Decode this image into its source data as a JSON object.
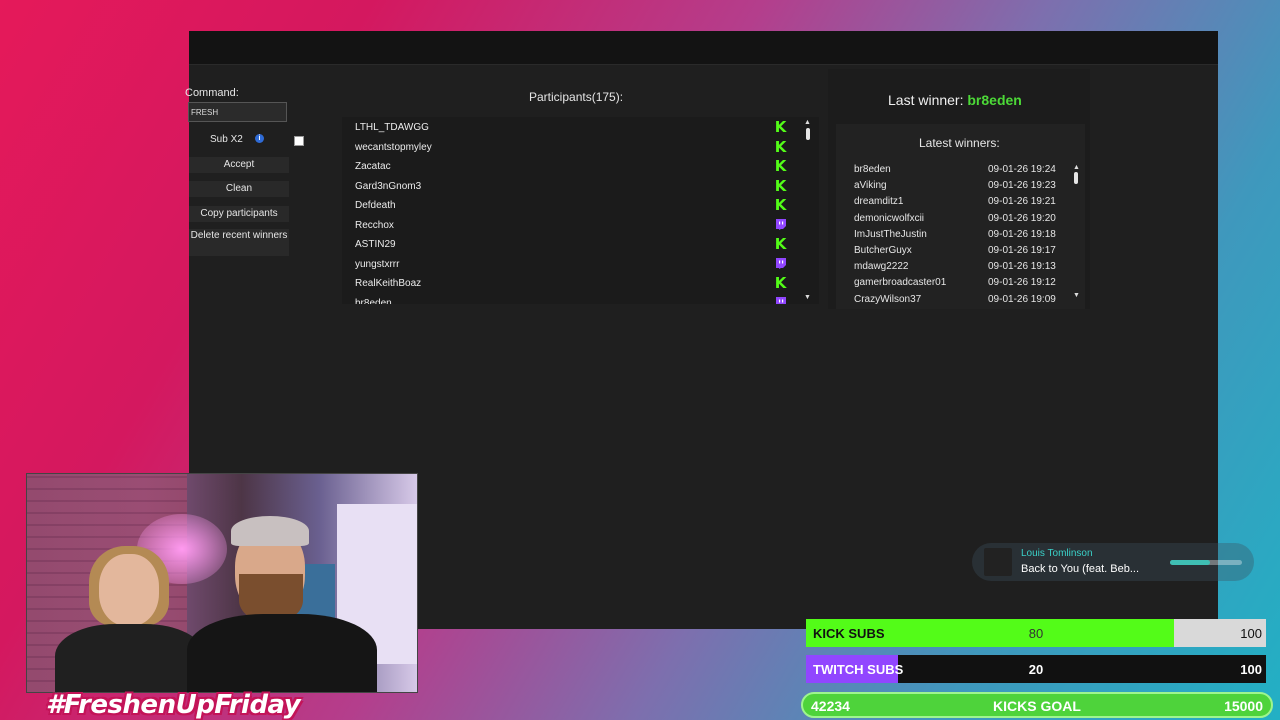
{
  "command": {
    "label": "Command:",
    "value": "FRESH"
  },
  "sub_x2": {
    "label": "Sub X2",
    "info_icon": "info-icon"
  },
  "buttons": {
    "accept": "Accept",
    "clean": "Clean",
    "copy": "Copy participants",
    "delete": "Delete recent winners"
  },
  "participants": {
    "title": "Participants(175):",
    "rows": [
      {
        "name": "LTHL_TDAWGG",
        "platform": "kick"
      },
      {
        "name": "wecantstopmyley",
        "platform": "kick"
      },
      {
        "name": "Zacatac",
        "platform": "kick"
      },
      {
        "name": "Gard3nGnom3",
        "platform": "kick"
      },
      {
        "name": "Defdeath",
        "platform": "kick"
      },
      {
        "name": "Recchox",
        "platform": "twitch"
      },
      {
        "name": "ASTIN29",
        "platform": "kick"
      },
      {
        "name": "yungstxrrr",
        "platform": "twitch"
      },
      {
        "name": "RealKeithBoaz",
        "platform": "kick"
      },
      {
        "name": "br8eden",
        "platform": "twitch"
      }
    ]
  },
  "last_winner": {
    "label": "Last winner:",
    "name": "br8eden"
  },
  "latest_winners": {
    "title": "Latest winners:",
    "rows": [
      {
        "name": "br8eden",
        "time": "09-01-26 19:24"
      },
      {
        "name": "aViking",
        "time": "09-01-26 19:23"
      },
      {
        "name": "dreamditz1",
        "time": "09-01-26 19:21"
      },
      {
        "name": "demonicwolfxcii",
        "time": "09-01-26 19:20"
      },
      {
        "name": "ImJustTheJustin",
        "time": "09-01-26 19:18"
      },
      {
        "name": "ButcherGuyx",
        "time": "09-01-26 19:17"
      },
      {
        "name": "mdawg2222",
        "time": "09-01-26 19:13"
      },
      {
        "name": "gamerbroadcaster01",
        "time": "09-01-26 19:12"
      },
      {
        "name": "CrazyWilson37",
        "time": "09-01-26 19:09"
      }
    ]
  },
  "now_playing": {
    "artist": "Louis Tomlinson",
    "title": "Back to You (feat. Beb...",
    "progress": 0.55
  },
  "overlay": {
    "hashtag": "#FreshenUpFriday",
    "kick_subs": {
      "label": "KICK SUBS",
      "value": "80",
      "max": "100",
      "fraction": 0.8,
      "color": "#53fc18"
    },
    "twitch_subs": {
      "label": "TWITCH SUBS",
      "value": "20",
      "max": "100",
      "fraction": 0.2,
      "color": "#9146ff"
    },
    "kicks_goal": {
      "current": "42234",
      "label": "KICKS GOAL",
      "max": "15000"
    }
  }
}
